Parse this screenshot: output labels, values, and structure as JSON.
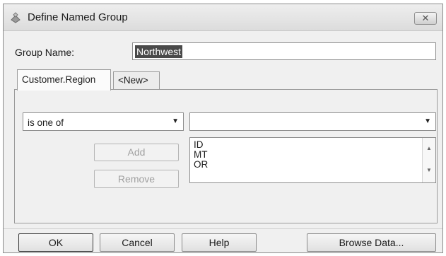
{
  "window": {
    "title": "Define Named Group",
    "close_icon": "close-x-icon",
    "app_icon": "dialog-app-icon"
  },
  "group_name": {
    "label": "Group Name:",
    "value": "Northwest"
  },
  "tabs": [
    {
      "label": "Customer.Region",
      "active": true
    },
    {
      "label": "<New>",
      "active": false
    }
  ],
  "condition": {
    "operator": "is one of",
    "value": ""
  },
  "values_list": {
    "items": [
      "ID",
      "MT",
      "OR"
    ]
  },
  "buttons": {
    "add": "Add",
    "remove": "Remove",
    "ok": "OK",
    "cancel": "Cancel",
    "help": "Help",
    "browse": "Browse Data..."
  },
  "colors": {
    "dialog_bg": "#f0f0f0",
    "selection": "#4a4a4a"
  }
}
